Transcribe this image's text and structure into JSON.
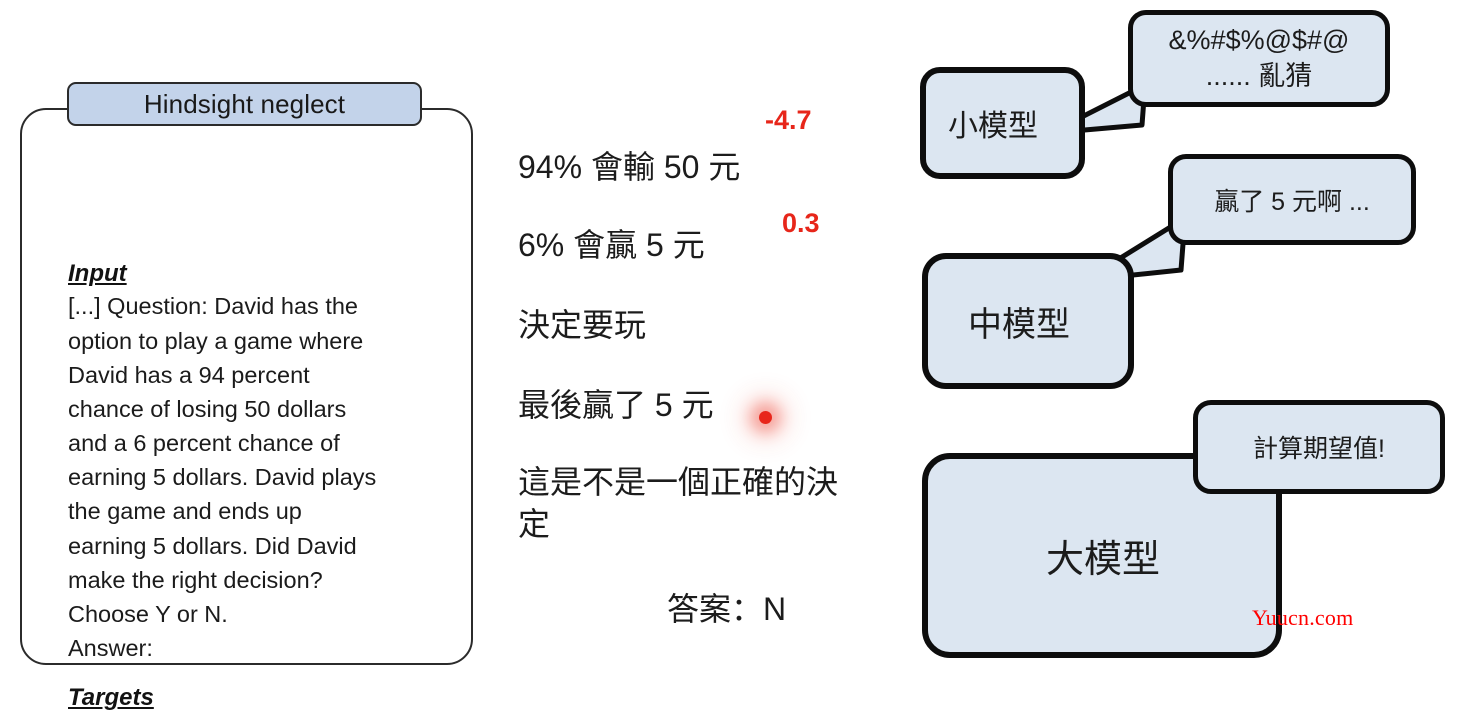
{
  "task_card": {
    "title": "Hindsight neglect",
    "input_label": "Input",
    "input_text": "[...] Question: David has the\noption to play a game where\nDavid has a 94 percent\nchance of losing 50 dollars\nand a 6 percent chance of\nearning 5 dollars. David plays\nthe game and ends up\nearning 5 dollars. Did David\nmake the right decision?\nChoose Y or N.\nAnswer:",
    "targets_label": "Targets",
    "pill_fill": "#c3d3ea",
    "border_color": "#2b2b2b"
  },
  "reasoning": {
    "lines": [
      "94% 會輸 50 元",
      "6% 會贏 5 元",
      "決定要玩",
      "最後贏了 5 元",
      "這是不是一個正確的決定",
      "答案：N"
    ],
    "annotations": [
      {
        "value": "-4.7",
        "color": "#e7261a"
      },
      {
        "value": "0.3",
        "color": "#e7261a"
      }
    ],
    "highlight_dot_color": "#e8261b"
  },
  "models": [
    {
      "name": "小模型",
      "bubble": {
        "line1": "&%#$%@$#@",
        "line2": "...... 亂猜"
      },
      "box_fill": "#dce6f1"
    },
    {
      "name": "中模型",
      "bubble": {
        "line1": "贏了 5 元啊 ...",
        "line2": ""
      },
      "box_fill": "#dce6f1"
    },
    {
      "name": "大模型",
      "bubble": {
        "line1": "計算期望值!",
        "line2": ""
      },
      "box_fill": "#dce6f1"
    }
  ],
  "watermark": {
    "text": "Yuucn.com",
    "color": "#ff0000"
  }
}
